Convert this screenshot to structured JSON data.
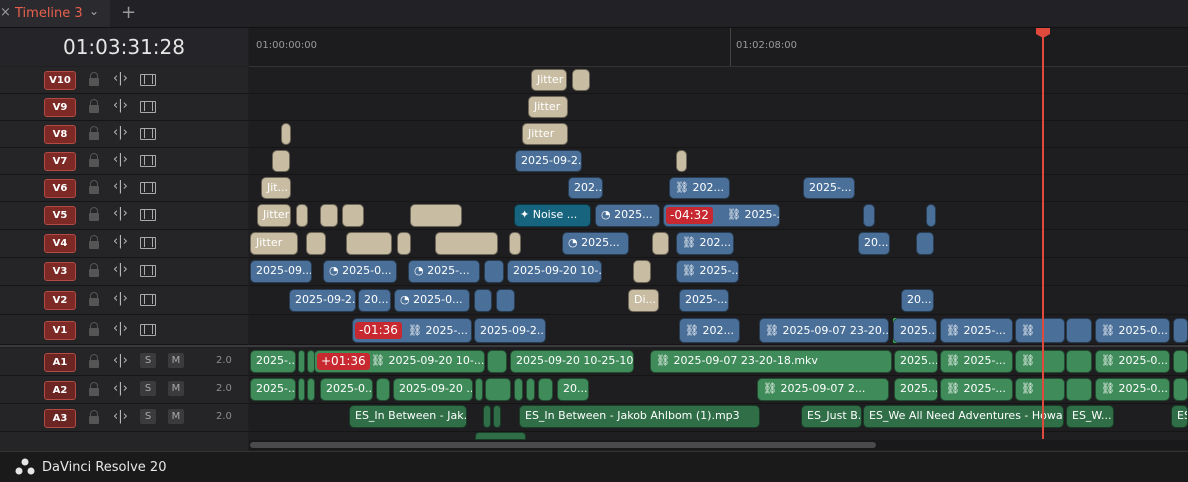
{
  "tab": {
    "close": "×",
    "title": "Timeline 3",
    "chevron": "⌄",
    "add": "+"
  },
  "timecode": "01:03:31:28",
  "ruler": {
    "t1": "01:00:00:00",
    "t2": "01:02:08:00"
  },
  "tracks": {
    "v10": "V10",
    "v9": "V9",
    "v8": "V8",
    "v7": "V7",
    "v6": "V6",
    "v5": "V5",
    "v4": "V4",
    "v3": "V3",
    "v2": "V2",
    "v1": "V1",
    "a1": "A1",
    "a2": "A2",
    "a3": "A3"
  },
  "audio": {
    "solo": "S",
    "mute": "M",
    "level": "2.0"
  },
  "clips": {
    "jitter": "Jitter",
    "jit": "Jit...",
    "noise": "Noise ...",
    "d0920_2": "2025-09-2...",
    "d202": "202...",
    "d2025": "2025-...",
    "d2025s": "2025...",
    "d20": "20...",
    "d0920": "2025-09-20",
    "v3a": "2025-09...",
    "v3b": "2025-0...",
    "v3c": "2025-...",
    "v3d": "2025-09-20 10-...",
    "v2a": "2025-09-2...",
    "v2b": "20...",
    "v2c": "2025-0...",
    "v2d": "Di...",
    "v1a": "2025-...",
    "v1b": "2025-09-2...",
    "v1c": "2025-09-07 23-20...",
    "v1d": "2025...",
    "v1e": "2025-...",
    "v1f": "2025-0...",
    "a1a": "2025-...",
    "a1b": "2025-09-20 10-...",
    "a1c": "2025-09-20 10-25-10...",
    "a1d": "2025-09-07 23-20-18.mkv",
    "a1e": "2025...",
    "a1f": "2025-...",
    "a1g": "2025-0...",
    "a2a": "2025-...",
    "a2b": "2025-0...",
    "a2c": "2025-09-20 ...",
    "a2d": "20...",
    "a2e": "2025-09-07 2...",
    "a2f": "2025...",
    "a2g": "2025-...",
    "a2h": "2025-0...",
    "a3a": "ES_In Between - Jak...",
    "a3b": "ES_In Between - Jakob Ahlbom (1).mp3",
    "a3c": "ES_Just B...",
    "a3d": "ES_We All Need Adventures - Howar...",
    "a3e": "ES_W...",
    "a3f": "ES..."
  },
  "badges": {
    "b1": "-04:32",
    "b2": "-01:36",
    "b3": "+01:36"
  },
  "footer": {
    "app": "DaVinci Resolve 20"
  },
  "icons": [
    "close-icon",
    "chevron-down-icon",
    "plus-icon",
    "lock-icon",
    "link-icon",
    "film-icon",
    "speed-icon",
    "sparkle-icon",
    "chain-icon",
    "davinci-logo-icon"
  ],
  "colors": {
    "accent": "#e04a3c",
    "video_clip": "#4a7099",
    "audio_clip": "#3f8c5a",
    "adjustment": "#c8bca2"
  }
}
